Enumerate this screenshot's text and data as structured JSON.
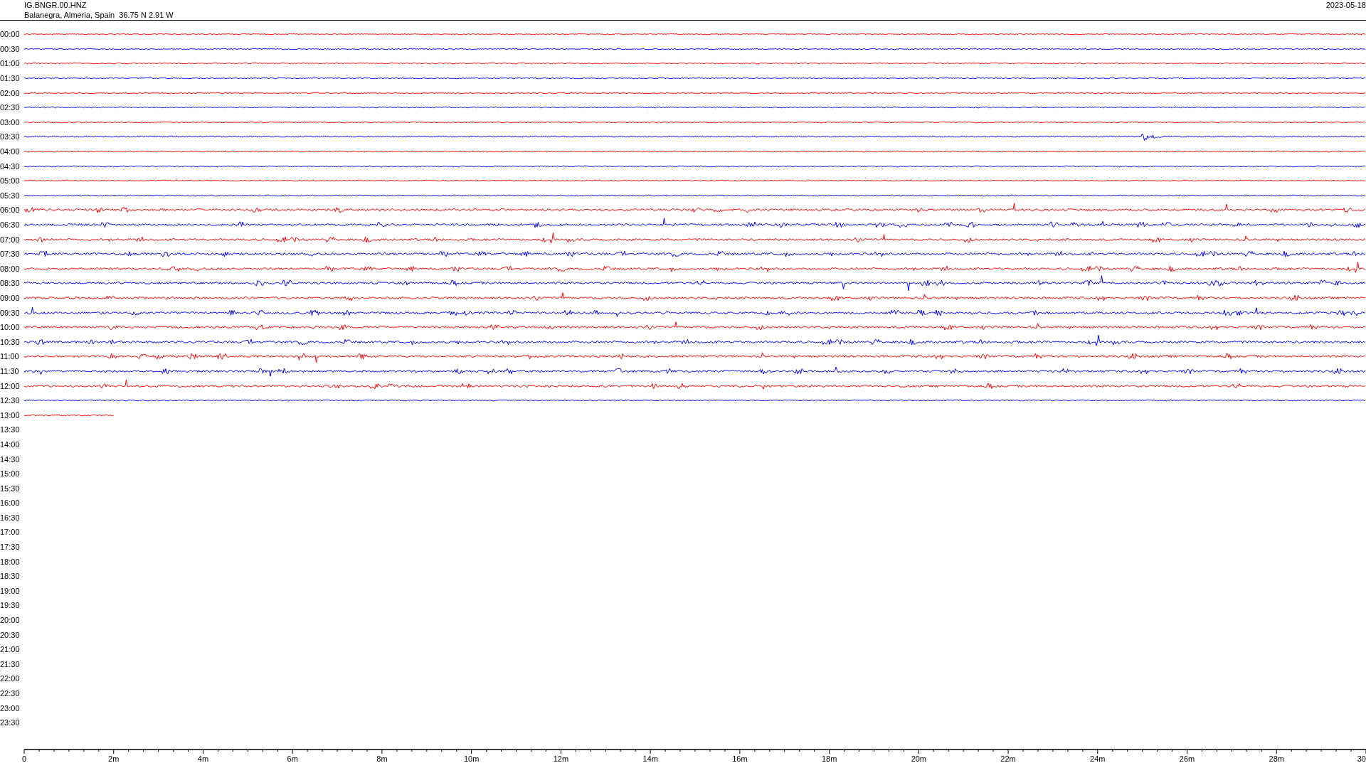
{
  "header": {
    "station": "IG.BNGR.00.HNZ",
    "location": "Balanegra, Almeria, Spain  36.75 N 2.91 W",
    "date": "2023-05-18"
  },
  "rows": [
    {
      "time": "00:00",
      "kind": "quiet",
      "color": "#ff0000",
      "level": 1
    },
    {
      "time": "00:30",
      "kind": "quiet",
      "color": "#0000ff",
      "level": 1
    },
    {
      "time": "01:00",
      "kind": "quiet",
      "color": "#ff0000",
      "level": 1
    },
    {
      "time": "01:30",
      "kind": "quiet",
      "color": "#0000ff",
      "level": 1
    },
    {
      "time": "02:00",
      "kind": "quiet",
      "color": "#ff0000",
      "level": 1
    },
    {
      "time": "02:30",
      "kind": "quiet",
      "color": "#0000ff",
      "level": 1
    },
    {
      "time": "03:00",
      "kind": "quiet",
      "color": "#ff0000",
      "level": 1
    },
    {
      "time": "03:30",
      "kind": "event",
      "color": "#0000ff",
      "level": 1
    },
    {
      "time": "04:00",
      "kind": "quiet",
      "color": "#ff0000",
      "level": 1
    },
    {
      "time": "04:30",
      "kind": "quiet",
      "color": "#0000ff",
      "level": 1
    },
    {
      "time": "05:00",
      "kind": "quiet",
      "color": "#ff0000",
      "level": 1
    },
    {
      "time": "05:30",
      "kind": "quiet",
      "color": "#0000ff",
      "level": 1
    },
    {
      "time": "06:00",
      "kind": "noisy",
      "color": "#ff0000",
      "level": 1
    },
    {
      "time": "06:30",
      "kind": "noisy",
      "color": "#0000ff",
      "level": 1
    },
    {
      "time": "07:00",
      "kind": "noisy",
      "color": "#ff0000",
      "level": 1
    },
    {
      "time": "07:30",
      "kind": "noisy",
      "color": "#0000ff",
      "level": 1
    },
    {
      "time": "08:00",
      "kind": "noisy",
      "color": "#ff0000",
      "level": 1
    },
    {
      "time": "08:30",
      "kind": "noisy",
      "color": "#0000ff",
      "level": 1
    },
    {
      "time": "09:00",
      "kind": "noisy",
      "color": "#ff0000",
      "level": 1
    },
    {
      "time": "09:30",
      "kind": "noisy",
      "color": "#0000ff",
      "level": 1
    },
    {
      "time": "10:00",
      "kind": "noisy",
      "color": "#ff0000",
      "level": 1
    },
    {
      "time": "10:30",
      "kind": "noisy",
      "color": "#0000ff",
      "level": 1
    },
    {
      "time": "11:00",
      "kind": "noisy",
      "color": "#ff0000",
      "level": 1
    },
    {
      "time": "11:30",
      "kind": "noisy",
      "color": "#0000ff",
      "level": 1
    },
    {
      "time": "12:00",
      "kind": "noisy",
      "color": "#ff0000",
      "level": 1
    },
    {
      "time": "12:30",
      "kind": "quiet",
      "color": "#0000ff",
      "level": 1
    },
    {
      "time": "13:00",
      "kind": "quiet",
      "color": "#ff0000",
      "level": 0.067
    },
    {
      "time": "13:30",
      "kind": "empty"
    },
    {
      "time": "14:00",
      "kind": "empty"
    },
    {
      "time": "14:30",
      "kind": "empty"
    },
    {
      "time": "15:00",
      "kind": "empty"
    },
    {
      "time": "15:30",
      "kind": "empty"
    },
    {
      "time": "16:00",
      "kind": "empty"
    },
    {
      "time": "16:30",
      "kind": "empty"
    },
    {
      "time": "17:00",
      "kind": "empty"
    },
    {
      "time": "17:30",
      "kind": "empty"
    },
    {
      "time": "18:00",
      "kind": "empty"
    },
    {
      "time": "18:30",
      "kind": "empty"
    },
    {
      "time": "19:00",
      "kind": "empty"
    },
    {
      "time": "19:30",
      "kind": "empty"
    },
    {
      "time": "20:00",
      "kind": "empty"
    },
    {
      "time": "20:30",
      "kind": "empty"
    },
    {
      "time": "21:00",
      "kind": "empty"
    },
    {
      "time": "21:30",
      "kind": "empty"
    },
    {
      "time": "22:00",
      "kind": "empty"
    },
    {
      "time": "22:30",
      "kind": "empty"
    },
    {
      "time": "23:00",
      "kind": "empty"
    },
    {
      "time": "23:30",
      "kind": "empty"
    }
  ],
  "x_axis": {
    "labels": [
      "0",
      "2m",
      "4m",
      "6m",
      "8m",
      "10m",
      "12m",
      "14m",
      "16m",
      "18m",
      "20m",
      "22m",
      "24m",
      "26m",
      "28m",
      "30"
    ]
  }
}
